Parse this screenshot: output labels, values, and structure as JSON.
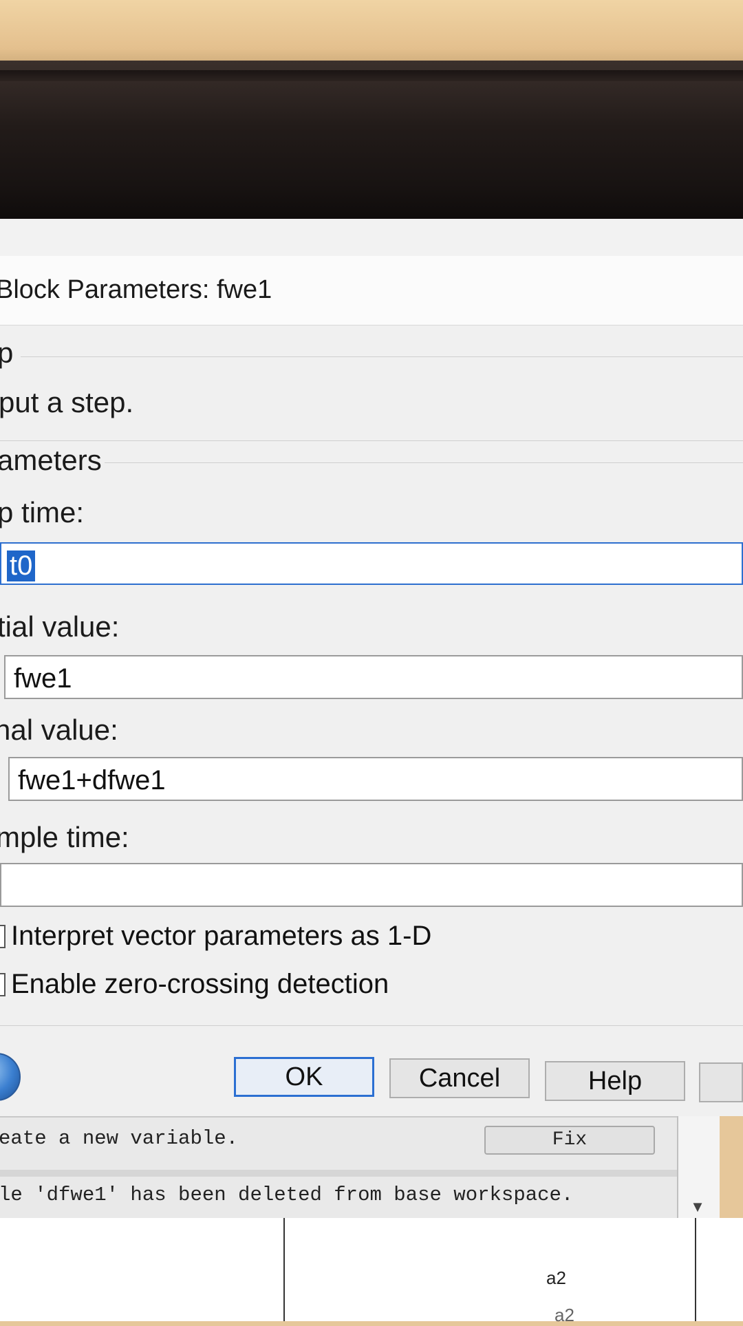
{
  "dialog": {
    "title": "Block Parameters: fwe1",
    "block_type": "p",
    "description": "put a step.",
    "section": "ameters"
  },
  "params": {
    "step_time": {
      "label": "p time:",
      "value": "t0"
    },
    "initial_value": {
      "label": "tial value:",
      "value": "fwe1"
    },
    "final_value": {
      "label": "nal value:",
      "value": "fwe1+dfwe1"
    },
    "sample_time": {
      "label": "mple time:",
      "value": ""
    }
  },
  "checkboxes": [
    {
      "label": "Interpret vector parameters as 1-D",
      "checked": false
    },
    {
      "label": "Enable zero-crossing detection",
      "checked": false
    }
  ],
  "buttons": {
    "ok": "OK",
    "cancel": "Cancel",
    "help": "Help"
  },
  "diagnostics": {
    "message_1": "eate a new variable.",
    "fix_label": "Fix",
    "message_2": "le 'dfwe1' has been deleted from base workspace."
  },
  "canvas": {
    "label_1": "a2",
    "label_2": "a2"
  },
  "colors": {
    "focus_blue": "#1f66c9",
    "primary_border": "#2b6fd2"
  }
}
